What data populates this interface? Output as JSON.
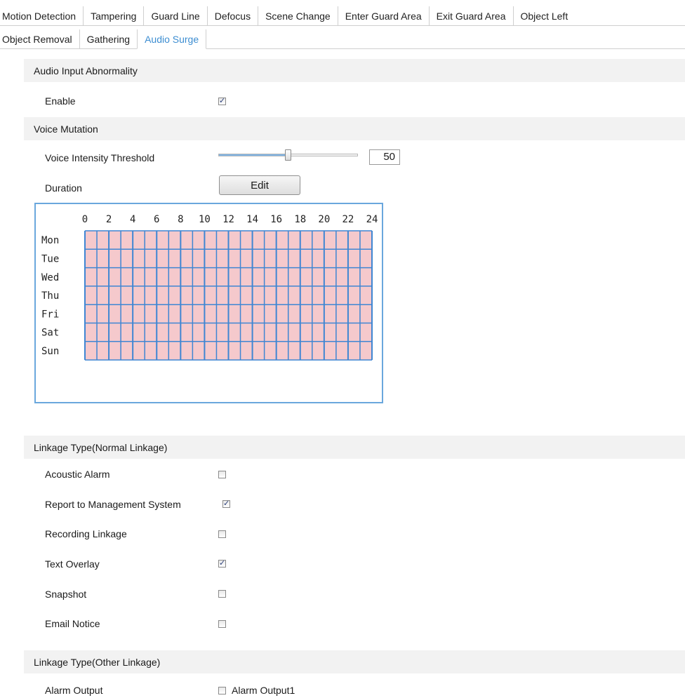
{
  "tabs_row1": [
    "Motion Detection",
    "Tampering",
    "Guard Line",
    "Defocus",
    "Scene Change",
    "Enter Guard Area",
    "Exit Guard Area",
    "Object Left"
  ],
  "tabs_row2": [
    "Object Removal",
    "Gathering",
    "Audio Surge"
  ],
  "active_tab": "Audio Surge",
  "audio_abnormality": {
    "title": "Audio Input Abnormality",
    "enable_label": "Enable",
    "enable_checked": true
  },
  "voice_mutation": {
    "title": "Voice Mutation",
    "threshold_label": "Voice Intensity Threshold",
    "threshold_value": "50",
    "threshold_fraction": 0.5,
    "duration_label": "Duration",
    "edit_label": "Edit"
  },
  "schedule": {
    "hours": [
      "0",
      "2",
      "4",
      "6",
      "8",
      "10",
      "12",
      "14",
      "16",
      "18",
      "20",
      "22",
      "24"
    ],
    "days": [
      "Mon",
      "Tue",
      "Wed",
      "Thu",
      "Fri",
      "Sat",
      "Sun"
    ],
    "fill_color": "#f5c9cc",
    "line_color": "#3f86d3",
    "all_day_armed": true
  },
  "normal_linkage": {
    "title": "Linkage Type(Normal Linkage)",
    "items": [
      {
        "label": "Acoustic Alarm",
        "checked": false
      },
      {
        "label": "Report to Management System",
        "checked": true
      },
      {
        "label": "Recording Linkage",
        "checked": false
      },
      {
        "label": "Text Overlay",
        "checked": true
      },
      {
        "label": "Snapshot",
        "checked": false
      },
      {
        "label": "Email Notice",
        "checked": false
      }
    ]
  },
  "other_linkage": {
    "title": "Linkage Type(Other Linkage)",
    "alarm_output_label": "Alarm Output",
    "alarm_output_option": "Alarm Output1",
    "alarm_output_checked": false
  },
  "colors": {
    "accent": "#3c8dd1",
    "section_bg": "#f2f2f2"
  }
}
